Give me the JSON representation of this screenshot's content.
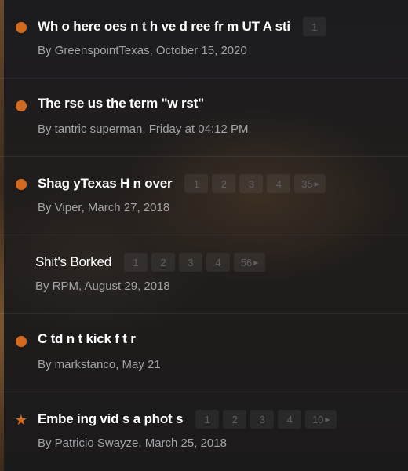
{
  "colors": {
    "unread_marker": "#d26a1f",
    "star_marker": "#d26a1f"
  },
  "threads": [
    {
      "title": "Wh  o  here  oes n  t h  ve   d   ree fr  m UT A  sti",
      "meta": "By GreenspointTexas, October 15, 2020",
      "marker": "dot",
      "pages": [
        "1"
      ]
    },
    {
      "title": "The     rse us       the term \"w  rst\"",
      "meta": "By tantric superman, Friday at 04:12 PM",
      "marker": "dot",
      "pages": []
    },
    {
      "title": "Shag  yTexas H  n  over",
      "meta": "By Viper, March 27, 2018",
      "marker": "dot",
      "pages": [
        "1",
        "2",
        "3",
        "4",
        "35"
      ]
    },
    {
      "title": "Shit's Borked",
      "meta": "By RPM, August 29, 2018",
      "marker": "none",
      "pages": [
        "1",
        "2",
        "3",
        "4",
        "56"
      ]
    },
    {
      "title": "C      td     n  t  kick   f  t      r",
      "meta": "By markstanco, May 21",
      "marker": "dot",
      "pages": []
    },
    {
      "title": "Embe    ing vid    s a    phot  s",
      "meta": "By Patricio Swayze, March 25, 2018",
      "marker": "star",
      "pages": [
        "1",
        "2",
        "3",
        "4",
        "10"
      ]
    }
  ]
}
